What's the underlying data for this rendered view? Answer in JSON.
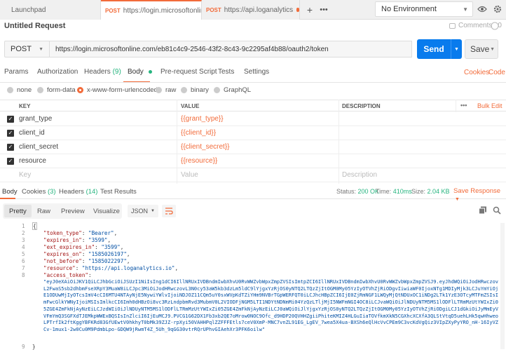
{
  "tabs": [
    {
      "label": "Launchpad",
      "method": ""
    },
    {
      "label": "https://login.microsoftonline.com...",
      "method": "POST",
      "active": true,
      "dot": true
    },
    {
      "label": "https://api.loganalytics.io/v1/...",
      "method": "POST",
      "dot": true
    }
  ],
  "env": {
    "selected": "No Environment"
  },
  "request": {
    "title": "Untitled Request",
    "comments_label": "Comments",
    "comments_count": "0",
    "method": "POST",
    "url": "https://login.microsoftonline.com/eb81c4c9-2546-43f2-8c43-9c2295af4b88/oauth2/token",
    "send_label": "Send",
    "save_label": "Save"
  },
  "request_tabs": {
    "params": "Params",
    "authorization": "Authorization",
    "headers": "Headers",
    "headers_count": "(9)",
    "body": "Body",
    "prerequest": "Pre-request Script",
    "tests": "Tests",
    "settings": "Settings",
    "cookies": "Cookies",
    "code": "Code"
  },
  "body_types": [
    "none",
    "form-data",
    "x-www-form-urlencoded",
    "raw",
    "binary",
    "GraphQL"
  ],
  "body_type_selected": "x-www-form-urlencoded",
  "table": {
    "headers": {
      "key": "KEY",
      "value": "VALUE",
      "description": "DESCRIPTION",
      "more": "•••",
      "bulk": "Bulk Edit"
    },
    "rows": [
      {
        "key": "grant_type",
        "value": "{{grant_type}}"
      },
      {
        "key": "client_id",
        "value": "{{client_id}}"
      },
      {
        "key": "client_secret",
        "value": "{{client_secret}}"
      },
      {
        "key": "resource",
        "value": "{{resource}}"
      }
    ],
    "placeholders": {
      "key": "Key",
      "value": "Value",
      "description": "Description"
    }
  },
  "response": {
    "tabs": {
      "body": "Body",
      "cookies": "Cookies",
      "cookies_count": "(3)",
      "headers": "Headers",
      "headers_count": "(14)",
      "tests": "Test Results"
    },
    "status_label": "Status:",
    "status": "200 OK",
    "time_label": "Time:",
    "time": "410ms",
    "size_label": "Size:",
    "size": "2.04 KB",
    "save_label": "Save Response",
    "views": [
      "Pretty",
      "Raw",
      "Preview",
      "Visualize"
    ],
    "format": "JSON",
    "json_lines": [
      {
        "n": "1",
        "text": "{"
      },
      {
        "n": "2",
        "key": "\"token_type\"",
        "val": "\"Bearer\""
      },
      {
        "n": "3",
        "key": "\"expires_in\"",
        "val": "\"3599\""
      },
      {
        "n": "4",
        "key": "\"ext_expires_in\"",
        "val": "\"3599\""
      },
      {
        "n": "5",
        "key": "\"expires_on\"",
        "val": "\"1585026197\""
      },
      {
        "n": "6",
        "key": "\"not_before\"",
        "val": "\"1585022297\""
      },
      {
        "n": "7",
        "key": "\"resource\"",
        "val": "\"https://api.loganalytics.io\""
      },
      {
        "n": "8",
        "key": "\"access_token\"",
        "val": ""
      }
    ],
    "access_token_text": "\"eyJ0eXAiOiJKV1QiLCJhbGciOiJSUzI1NiIsIng1dCI6IllNRUxIVDBndmIwbXhvU0RvWWZvbWpxZmpZVSIsImtpZCI6IllNRUxIVDBndmIwbXhvU0RvWWZvbWpxZmpZVSJ9.eyJhdWQiOiJodHRwczovL2FwaS5sb2dhbmFseXRpY3MuaW8iLCJpc3MiOiJodHRwczovL3N0cy53aW5kb3dzLm5ldC9lYjgxYzRjOS0yNTQ2LTQzZjItOGM0My05YzIyOTVhZjRiODgvIiwiaWF0IjoxNTg1MDIyMjk3LCJuYmYiOjE1ODUwMjIyOTcsImV4cCI6MTU4NTAyNjE5NywiYWlvIjoiNDJOZ11CQm5uY0sxWVpKdTZiYHm9NVBrTGpWERFQT0iLCJhcHBpZCI6IjE0ZjRmNGF1LWQyMjQtNDUxOC1iNDg2LTk1YzE3OTcyMTFmZSIsImFwcGlkYWNyIjoiMSIsImlkcCI6Imh0dHBzOi8vc3RzLndpbmRvd3MubmV0L2VIODFjNGM5LTI1NDYtNDNmMi04YzQzLTljMjI5NWFmNGI4OC8iLCJvaWQiOiJlNDUyNTM5MS1lODFlLTRmMzUtYWIxZi05ZGE4ZmFkNjAyNzEiLCJzdWIiOiJlNDUyNTM5MS1lODFlLTRmMzUtYWIxZi05ZGE4ZmFkNjAyNzEiLCJ0aWQiOiJlYjgxYzRjOS0yNTQ2LTQzZjItOGM0My05YzIyOTVhZjRiODgiLCJ1dGkiOiJyMmEyVVFmYmQ3SGFXdTJEMkpWWExBQSIsInZlciI6IjEuMCJ9.PVCG1G62DX1Fb3xb2QE7oMrow0NOC9Ofc_d9HDP20QVHHZgiiPhiteKMIZ4HLGuIiaTOVfkmXkN5CGXhcXCXfA3QLStVtqD5uehLHk5qwHhweoLPTrfIk2ftKggYBFKRd83GfUEwtV0hkhyT0bMk39ZJZ-rpXyi50VAHHPqlZZFFFEtls7ceV0XmP-MNC7vnZL91EG_LgEV_7wea5X4ua-BXSh6eQlHcVvCPEm9C3vcKdVgQiz3VIpZXyPyYRO_nH-16IyVZCv-1mux1-2w0Cu0M9PdmbLpo-GDQW9jRwmT4Z_5Uh_9qGG30vtrRQrUPhvGIAehXr3PFK6oilw\"",
    "last_line_number": "9",
    "last_line_text": "}"
  }
}
